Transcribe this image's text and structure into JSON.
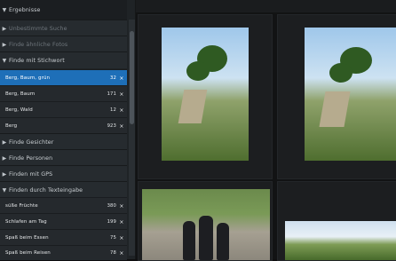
{
  "sidebar": {
    "header": "Ergebnisse",
    "sections": [
      {
        "label": "Unbestimmte Suche",
        "disabled": true
      },
      {
        "label": "Finde ähnliche Fotos",
        "disabled": true
      },
      {
        "label": "Finde mit Stichwort",
        "expanded": true
      },
      {
        "label": "Finde Gesichter"
      },
      {
        "label": "Finde Personen"
      },
      {
        "label": "Finden mit GPS"
      },
      {
        "label": "Finden durch Texteingabe",
        "expanded": true
      }
    ],
    "keyword_items": [
      {
        "label": "Berg, Baum, grün",
        "count": "32",
        "selected": true
      },
      {
        "label": "Berg, Baum",
        "count": "171"
      },
      {
        "label": "Berg, Wald",
        "count": "12"
      },
      {
        "label": "Berg",
        "count": "923"
      }
    ],
    "text_items": [
      {
        "label": "süße Früchte",
        "count": "380"
      },
      {
        "label": "Schlafen am Tag",
        "count": "199"
      },
      {
        "label": "Spaß beim Essen",
        "count": "75"
      },
      {
        "label": "Spaß beim Reisen",
        "count": "78"
      }
    ],
    "remove_glyph": "×",
    "caret_right": "▶",
    "caret_down": "▼"
  },
  "gallery": {
    "photos": [
      {
        "name": "cliff-photo-1"
      },
      {
        "name": "cliff-photo-2"
      },
      {
        "name": "group-photo"
      },
      {
        "name": "panorama-photo"
      }
    ]
  },
  "colors": {
    "selection": "#1e6fb8",
    "sidebar_bg": "#1f2326"
  }
}
